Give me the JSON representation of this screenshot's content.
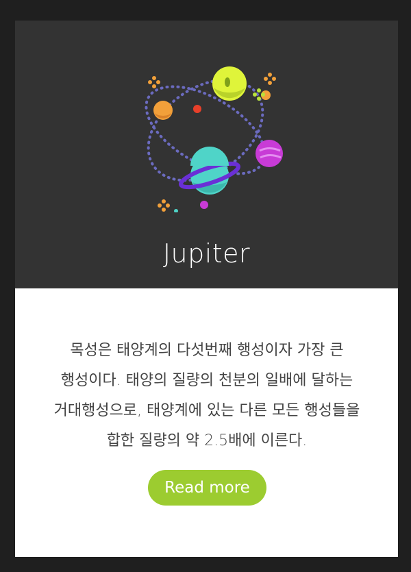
{
  "card": {
    "title": "Jupiter",
    "description": "목성은 태양계의 다섯번째 행성이자 가장 큰 행성이다. 태양의 질량의 천분의 일배에 달하는 거대행성으로, 태양계에 있는 다른 모든 행성들을 합한 질량의 약 2.5배에 이른다.",
    "button_label": "Read more",
    "illustration_icon": "planet-system-icon"
  },
  "colors": {
    "page_bg": "#1f1f1f",
    "card_top_bg": "#333333",
    "card_bottom_bg": "#ffffff",
    "button_bg": "#9ccc30",
    "orbit_dots": "#6b6bbf",
    "planet_lime": "#dff43a",
    "planet_teal": "#4fd4c8",
    "planet_magenta": "#c83bd6",
    "planet_orange": "#f2a03a"
  }
}
